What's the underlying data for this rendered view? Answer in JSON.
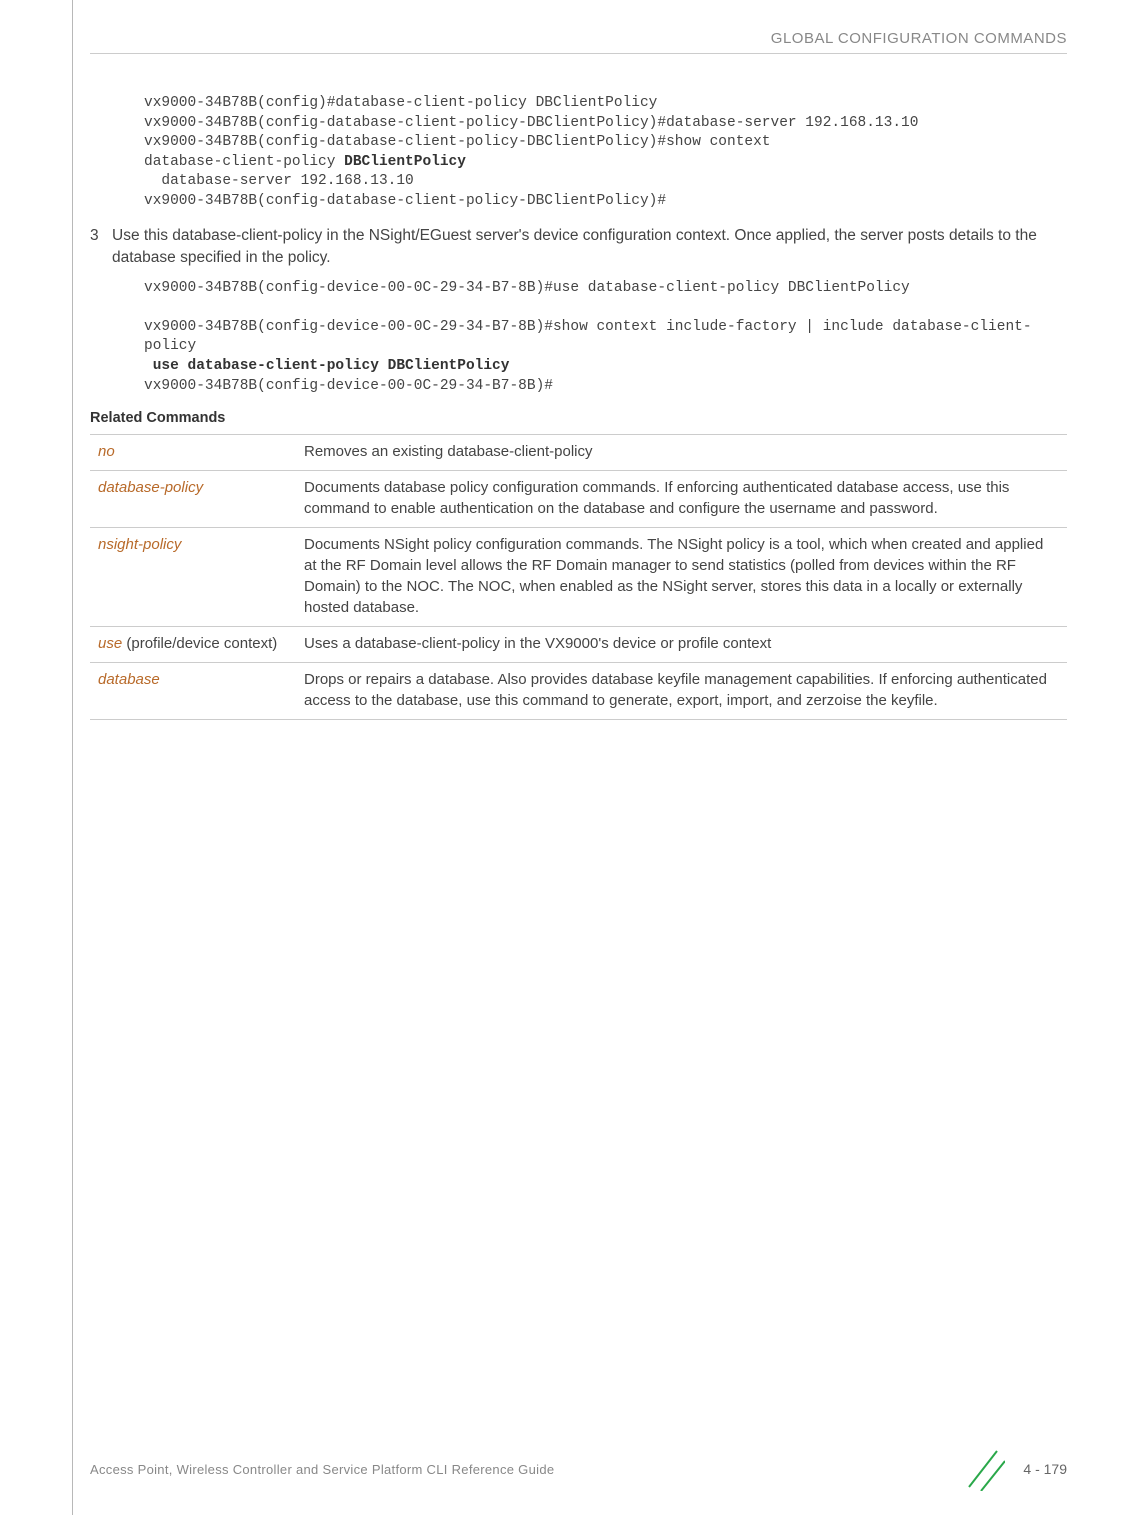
{
  "header": {
    "title": "GLOBAL CONFIGURATION COMMANDS"
  },
  "code1": {
    "l1": "vx9000-34B78B(config)#database-client-policy DBClientPolicy",
    "l2": "vx9000-34B78B(config-database-client-policy-DBClientPolicy)#database-server 192.168.13.10",
    "l3": "vx9000-34B78B(config-database-client-policy-DBClientPolicy)#show context",
    "l4a": "database-client-policy ",
    "l4b": "DBClientPolicy",
    "l5": "  database-server 192.168.13.10",
    "l6": "vx9000-34B78B(config-database-client-policy-DBClientPolicy)#"
  },
  "step3": {
    "num": "3",
    "text": "Use this database-client-policy in the NSight/EGuest server's device configuration context. Once applied, the server posts details to the database specified in the policy."
  },
  "code2": {
    "l1": "vx9000-34B78B(config-device-00-0C-29-34-B7-8B)#use database-client-policy DBClientPolicy",
    "l2": "",
    "l3": "vx9000-34B78B(config-device-00-0C-29-34-B7-8B)#show context include-factory | include database-client-policy",
    "l4": " use database-client-policy DBClientPolicy",
    "l5": "vx9000-34B78B(config-device-00-0C-29-34-B7-8B)#"
  },
  "related": {
    "label": "Related Commands",
    "rows": [
      {
        "cmd": "no",
        "desc": "Removes an existing database-client-policy"
      },
      {
        "cmd": "database-policy",
        "desc": "Documents database policy configuration commands. If enforcing authenticated database access, use this command to enable authentication on the database and configure the username and password."
      },
      {
        "cmd": "nsight-policy",
        "desc": "Documents NSight policy configuration commands. The NSight policy is a tool, which when created and applied at the RF Domain level allows the RF Domain manager to send statistics (polled from devices within the RF Domain) to the NOC. The NOC, when enabled as the NSight server, stores this data in a locally or externally hosted database."
      },
      {
        "cmd": "use",
        "cmd_suffix": " (profile/device context)",
        "desc": "Uses a database-client-policy in the VX9000's device or profile context"
      },
      {
        "cmd": "database",
        "desc": "Drops or repairs a database. Also provides database keyfile management capabilities. If enforcing authenticated access to the database, use this command to generate, export, import, and zerzoise the keyfile."
      }
    ]
  },
  "footer": {
    "title": "Access Point, Wireless Controller and Service Platform CLI Reference Guide",
    "page": "4 - 179"
  }
}
